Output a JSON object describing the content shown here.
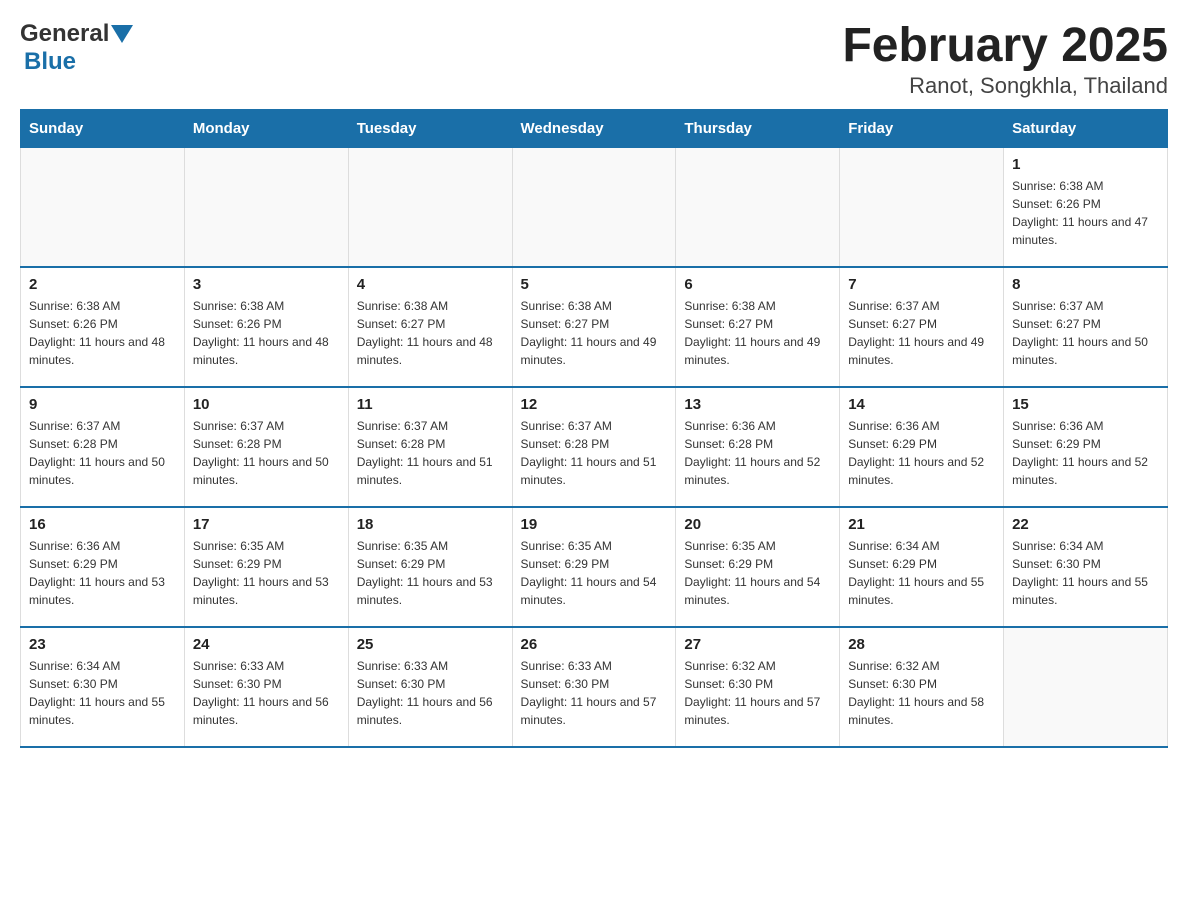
{
  "logo": {
    "general": "General",
    "blue": "Blue",
    "arrow_color": "#1a6fa8"
  },
  "title": "February 2025",
  "subtitle": "Ranot, Songkhla, Thailand",
  "weekdays": [
    "Sunday",
    "Monday",
    "Tuesday",
    "Wednesday",
    "Thursday",
    "Friday",
    "Saturday"
  ],
  "weeks": [
    [
      {
        "day": "",
        "info": ""
      },
      {
        "day": "",
        "info": ""
      },
      {
        "day": "",
        "info": ""
      },
      {
        "day": "",
        "info": ""
      },
      {
        "day": "",
        "info": ""
      },
      {
        "day": "",
        "info": ""
      },
      {
        "day": "1",
        "info": "Sunrise: 6:38 AM\nSunset: 6:26 PM\nDaylight: 11 hours and 47 minutes."
      }
    ],
    [
      {
        "day": "2",
        "info": "Sunrise: 6:38 AM\nSunset: 6:26 PM\nDaylight: 11 hours and 48 minutes."
      },
      {
        "day": "3",
        "info": "Sunrise: 6:38 AM\nSunset: 6:26 PM\nDaylight: 11 hours and 48 minutes."
      },
      {
        "day": "4",
        "info": "Sunrise: 6:38 AM\nSunset: 6:27 PM\nDaylight: 11 hours and 48 minutes."
      },
      {
        "day": "5",
        "info": "Sunrise: 6:38 AM\nSunset: 6:27 PM\nDaylight: 11 hours and 49 minutes."
      },
      {
        "day": "6",
        "info": "Sunrise: 6:38 AM\nSunset: 6:27 PM\nDaylight: 11 hours and 49 minutes."
      },
      {
        "day": "7",
        "info": "Sunrise: 6:37 AM\nSunset: 6:27 PM\nDaylight: 11 hours and 49 minutes."
      },
      {
        "day": "8",
        "info": "Sunrise: 6:37 AM\nSunset: 6:27 PM\nDaylight: 11 hours and 50 minutes."
      }
    ],
    [
      {
        "day": "9",
        "info": "Sunrise: 6:37 AM\nSunset: 6:28 PM\nDaylight: 11 hours and 50 minutes."
      },
      {
        "day": "10",
        "info": "Sunrise: 6:37 AM\nSunset: 6:28 PM\nDaylight: 11 hours and 50 minutes."
      },
      {
        "day": "11",
        "info": "Sunrise: 6:37 AM\nSunset: 6:28 PM\nDaylight: 11 hours and 51 minutes."
      },
      {
        "day": "12",
        "info": "Sunrise: 6:37 AM\nSunset: 6:28 PM\nDaylight: 11 hours and 51 minutes."
      },
      {
        "day": "13",
        "info": "Sunrise: 6:36 AM\nSunset: 6:28 PM\nDaylight: 11 hours and 52 minutes."
      },
      {
        "day": "14",
        "info": "Sunrise: 6:36 AM\nSunset: 6:29 PM\nDaylight: 11 hours and 52 minutes."
      },
      {
        "day": "15",
        "info": "Sunrise: 6:36 AM\nSunset: 6:29 PM\nDaylight: 11 hours and 52 minutes."
      }
    ],
    [
      {
        "day": "16",
        "info": "Sunrise: 6:36 AM\nSunset: 6:29 PM\nDaylight: 11 hours and 53 minutes."
      },
      {
        "day": "17",
        "info": "Sunrise: 6:35 AM\nSunset: 6:29 PM\nDaylight: 11 hours and 53 minutes."
      },
      {
        "day": "18",
        "info": "Sunrise: 6:35 AM\nSunset: 6:29 PM\nDaylight: 11 hours and 53 minutes."
      },
      {
        "day": "19",
        "info": "Sunrise: 6:35 AM\nSunset: 6:29 PM\nDaylight: 11 hours and 54 minutes."
      },
      {
        "day": "20",
        "info": "Sunrise: 6:35 AM\nSunset: 6:29 PM\nDaylight: 11 hours and 54 minutes."
      },
      {
        "day": "21",
        "info": "Sunrise: 6:34 AM\nSunset: 6:29 PM\nDaylight: 11 hours and 55 minutes."
      },
      {
        "day": "22",
        "info": "Sunrise: 6:34 AM\nSunset: 6:30 PM\nDaylight: 11 hours and 55 minutes."
      }
    ],
    [
      {
        "day": "23",
        "info": "Sunrise: 6:34 AM\nSunset: 6:30 PM\nDaylight: 11 hours and 55 minutes."
      },
      {
        "day": "24",
        "info": "Sunrise: 6:33 AM\nSunset: 6:30 PM\nDaylight: 11 hours and 56 minutes."
      },
      {
        "day": "25",
        "info": "Sunrise: 6:33 AM\nSunset: 6:30 PM\nDaylight: 11 hours and 56 minutes."
      },
      {
        "day": "26",
        "info": "Sunrise: 6:33 AM\nSunset: 6:30 PM\nDaylight: 11 hours and 57 minutes."
      },
      {
        "day": "27",
        "info": "Sunrise: 6:32 AM\nSunset: 6:30 PM\nDaylight: 11 hours and 57 minutes."
      },
      {
        "day": "28",
        "info": "Sunrise: 6:32 AM\nSunset: 6:30 PM\nDaylight: 11 hours and 58 minutes."
      },
      {
        "day": "",
        "info": ""
      }
    ]
  ]
}
